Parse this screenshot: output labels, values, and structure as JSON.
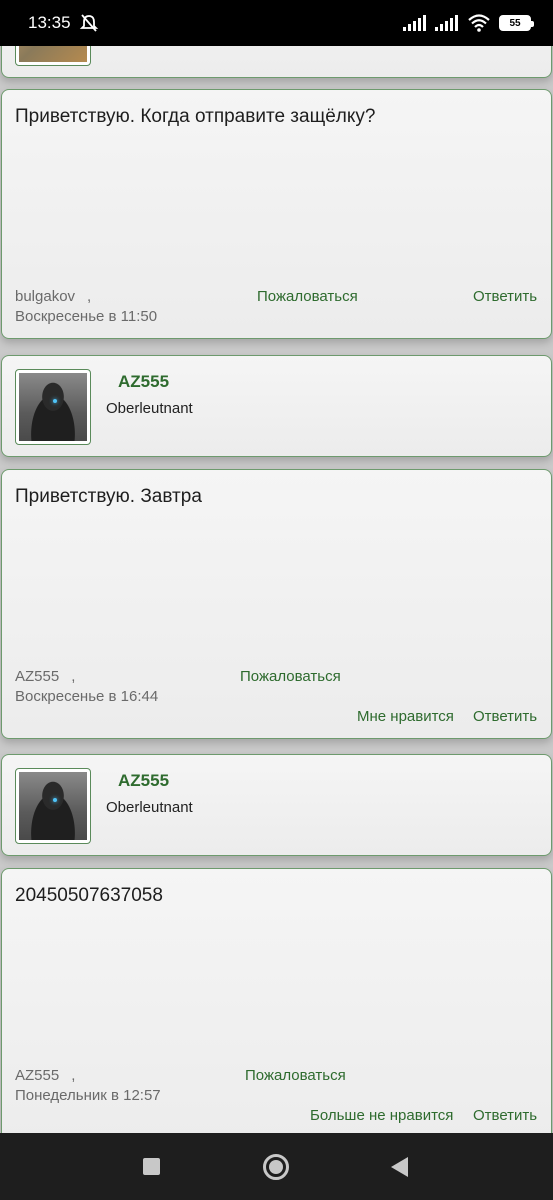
{
  "status_bar": {
    "time": "13:35",
    "battery": "55",
    "icons": [
      "muted-bell-icon",
      "signal-icon",
      "signal-icon",
      "wifi-icon",
      "battery-icon"
    ]
  },
  "posts": [
    {
      "text": "Приветствую. Когда отправите защёлку?",
      "author": "bulgakov",
      "comma": ",",
      "date": "Воскресенье в 11:50",
      "report": "Пожаловаться",
      "reply": "Ответить"
    },
    {
      "text": "Приветствую. Завтра",
      "author": "AZ555",
      "comma": ",",
      "date": "Воскресенье в 16:44",
      "report": "Пожаловаться",
      "like": "Мне нравится",
      "reply": "Ответить"
    },
    {
      "text": "20450507637058",
      "author": "AZ555",
      "comma": ",",
      "date": "Понедельник в 12:57",
      "report": "Пожаловаться",
      "like": "Больше не нравится",
      "reply": "Ответить"
    }
  ],
  "authors": [
    {
      "name": "AZ555",
      "rank": "Oberleutnant"
    },
    {
      "name": "AZ555",
      "rank": "Oberleutnant"
    }
  ],
  "nav": {
    "icons": [
      "recent-apps-icon",
      "home-icon",
      "back-icon"
    ]
  }
}
